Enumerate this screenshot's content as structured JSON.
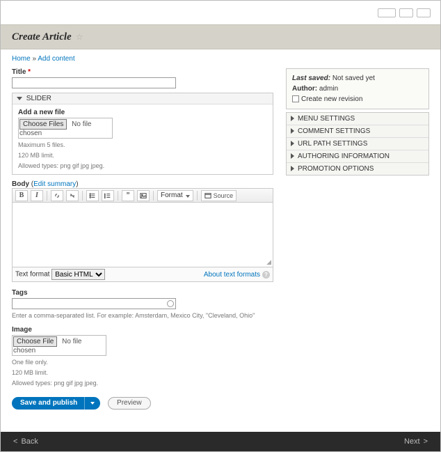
{
  "header": {
    "title": "Create Article"
  },
  "breadcrumb": {
    "home": "Home",
    "current": "Add content"
  },
  "title_field": {
    "label": "Title"
  },
  "slider": {
    "heading": "SLIDER",
    "add_label": "Add a new file",
    "choose_btn": "Choose Files",
    "choose_status": "No file chosen",
    "hint1": "Maximum 5 files.",
    "hint2": "120 MB limit.",
    "hint3": "Allowed types: png gif jpg jpeg."
  },
  "body": {
    "label": "Body",
    "edit_summary": "Edit summary",
    "format_dd": "Format",
    "source_btn": "Source",
    "text_format_label": "Text format",
    "text_format_value": "Basic HTML",
    "about_link": "About text formats"
  },
  "tags": {
    "label": "Tags",
    "hint": "Enter a comma-separated list. For example: Amsterdam, Mexico City, \"Cleveland, Ohio\""
  },
  "image": {
    "label": "Image",
    "choose_btn": "Choose File",
    "choose_status": "No file chosen",
    "hint1": "One file only.",
    "hint2": "120 MB limit.",
    "hint3": "Allowed types: png gif jpg jpeg."
  },
  "actions": {
    "save": "Save and publish",
    "preview": "Preview"
  },
  "meta": {
    "last_saved_label": "Last saved:",
    "last_saved_value": "Not saved yet",
    "author_label": "Author:",
    "author_value": "admin",
    "new_revision": "Create new revision"
  },
  "accordion": {
    "menu": "MENU SETTINGS",
    "comment": "COMMENT SETTINGS",
    "url": "URL PATH SETTINGS",
    "authoring": "AUTHORING INFORMATION",
    "promotion": "PROMOTION OPTIONS"
  },
  "footer": {
    "back": "Back",
    "next": "Next"
  }
}
